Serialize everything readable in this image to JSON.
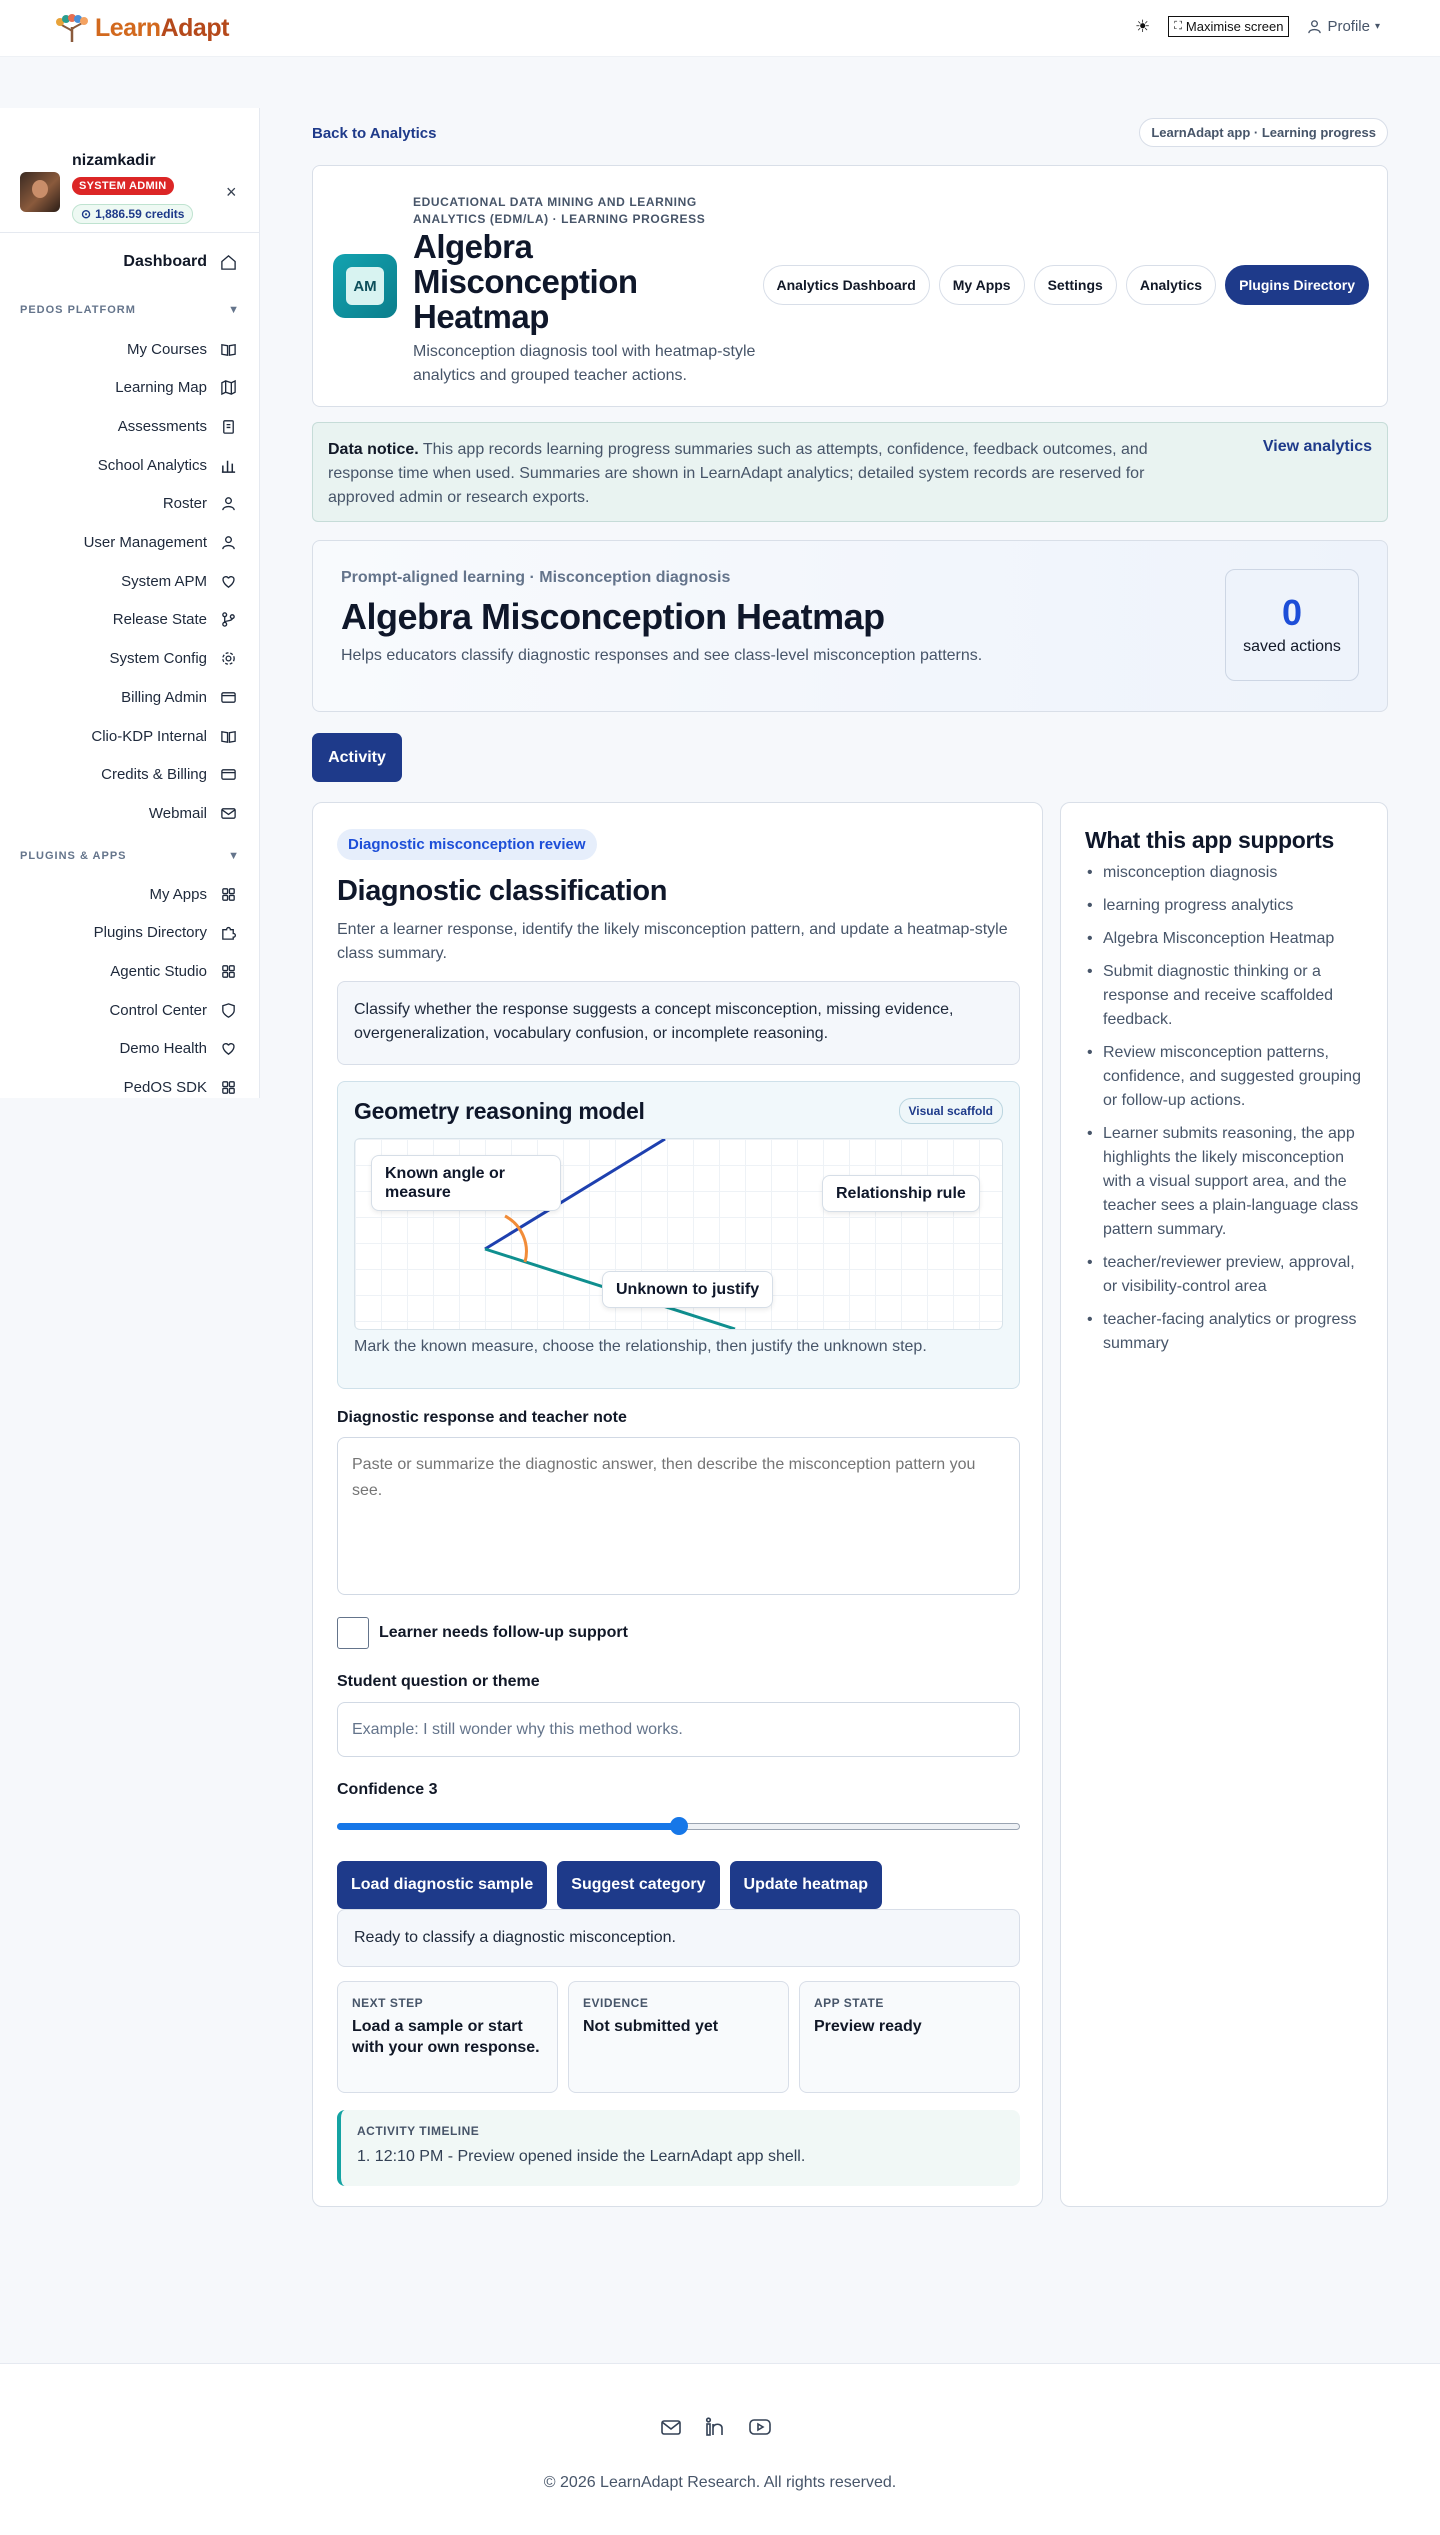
{
  "brand": {
    "name_lead": "Learn",
    "name_rest": "Adapt"
  },
  "topbar": {
    "maximise_label": "Maximise screen",
    "profile_label": "Profile"
  },
  "user": {
    "name": "nizamkadir",
    "role": "SYSTEM ADMIN",
    "credits": "1,886.59 credits"
  },
  "sidebar": {
    "dashboard": "Dashboard",
    "section_platform": "PEDOS PLATFORM",
    "platform_items": [
      {
        "label": "My Courses",
        "icon": "book-open-icon"
      },
      {
        "label": "Learning Map",
        "icon": "map-icon"
      },
      {
        "label": "Assessments",
        "icon": "clipboard-icon"
      },
      {
        "label": "School Analytics",
        "icon": "bar-chart-icon"
      },
      {
        "label": "Roster",
        "icon": "users-icon"
      },
      {
        "label": "User Management",
        "icon": "user-cog-icon"
      },
      {
        "label": "System APM",
        "icon": "heart-pulse-icon"
      },
      {
        "label": "Release State",
        "icon": "git-branch-icon"
      },
      {
        "label": "System Config",
        "icon": "gear-icon"
      },
      {
        "label": "Billing Admin",
        "icon": "credit-card-icon"
      },
      {
        "label": "Clio-KDP Internal",
        "icon": "book-open-icon"
      },
      {
        "label": "Credits & Billing",
        "icon": "credit-card-icon"
      },
      {
        "label": "Webmail",
        "icon": "mail-icon"
      }
    ],
    "section_plugins": "PLUGINS & APPS",
    "plugin_items": [
      {
        "label": "My Apps",
        "icon": "grid-icon"
      },
      {
        "label": "Plugins Directory",
        "icon": "puzzle-icon"
      },
      {
        "label": "Agentic Studio",
        "icon": "grid-icon"
      },
      {
        "label": "Control Center",
        "icon": "shield-icon"
      },
      {
        "label": "Demo Health",
        "icon": "heart-icon"
      },
      {
        "label": "PedOS SDK",
        "icon": "grid-icon"
      }
    ]
  },
  "page": {
    "back_link": "Back to Analytics",
    "app_pill": "LearnAdapt app · Learning progress",
    "header": {
      "icon_text": "AM",
      "eyebrow": "EDUCATIONAL DATA MINING AND LEARNING ANALYTICS (EDM/LA) · LEARNING PROGRESS",
      "title": "Algebra Misconception Heatmap",
      "description": "Misconception diagnosis tool with heatmap-style analytics and grouped teacher actions.",
      "nav": [
        "Analytics Dashboard",
        "My Apps",
        "Settings",
        "Analytics",
        "Plugins Directory"
      ]
    },
    "notice": {
      "label": "Data notice.",
      "text": " This app records learning progress summaries such as attempts, confidence, feedback outcomes, and response time when used. Summaries are shown in LearnAdapt analytics; detailed system records are reserved for approved admin or research exports.",
      "link": "View analytics"
    },
    "hero": {
      "eyebrow": "Prompt-aligned learning · Misconception diagnosis",
      "title": "Algebra Misconception Heatmap",
      "description": "Helps educators classify diagnostic responses and see class-level misconception patterns.",
      "saved_count": "0",
      "saved_label": "saved actions"
    },
    "tab": "Activity"
  },
  "activity": {
    "badge": "Diagnostic misconception review",
    "title": "Diagnostic classification",
    "description": "Enter a learner response, identify the likely misconception pattern, and update a heatmap-style class summary.",
    "instruction": "Classify whether the response suggests a concept misconception, missing evidence, overgeneralization, vocabulary confusion, or incomplete reasoning.",
    "geometry": {
      "title": "Geometry reasoning model",
      "badge": "Visual scaffold",
      "label_known": "Known angle or measure",
      "label_rule": "Relationship rule",
      "label_unknown": "Unknown to justify",
      "caption": "Mark the known measure, choose the relationship, then justify the unknown step."
    },
    "response_label": "Diagnostic response and teacher note",
    "response_placeholder": "Paste or summarize the diagnostic answer, then describe the misconception pattern you see.",
    "followup_label": "Learner needs follow-up support",
    "question_label": "Student question or theme",
    "question_placeholder": "Example: I still wonder why this method works.",
    "confidence_label": "Confidence 3",
    "confidence": {
      "value": 3,
      "min": 1,
      "max": 5
    },
    "buttons": [
      "Load diagnostic sample",
      "Suggest category",
      "Update heatmap"
    ],
    "status": "Ready to classify a diagnostic misconception.",
    "info": [
      {
        "key": "NEXT STEP",
        "value": "Load a sample or start with your own response."
      },
      {
        "key": "EVIDENCE",
        "value": "Not submitted yet"
      },
      {
        "key": "APP STATE",
        "value": "Preview ready"
      }
    ],
    "timeline_label": "ACTIVITY TIMELINE",
    "timeline_items": [
      "12:10 PM - Preview opened inside the LearnAdapt app shell."
    ]
  },
  "supports": {
    "title": "What this app supports",
    "items": [
      "misconception diagnosis",
      "learning progress analytics",
      "Algebra Misconception Heatmap",
      "Submit diagnostic thinking or a response and receive scaffolded feedback.",
      "Review misconception patterns, confidence, and suggested grouping or follow-up actions.",
      "Learner submits reasoning, the app highlights the likely misconception with a visual support area, and the teacher sees a plain-language class pattern summary.",
      "teacher/reviewer preview, approval, or visibility-control area",
      "teacher-facing analytics or progress summary"
    ]
  },
  "footer": {
    "icons": [
      "mail-icon",
      "linkedin-icon",
      "youtube-icon"
    ],
    "copyright": "© 2026 LearnAdapt Research. All rights reserved."
  },
  "colors": {
    "primary": "#1e3a8a",
    "accent": "#1d4ed8",
    "danger": "#dc2626",
    "teal": "#14a3a3",
    "brand": "#b5491b"
  }
}
